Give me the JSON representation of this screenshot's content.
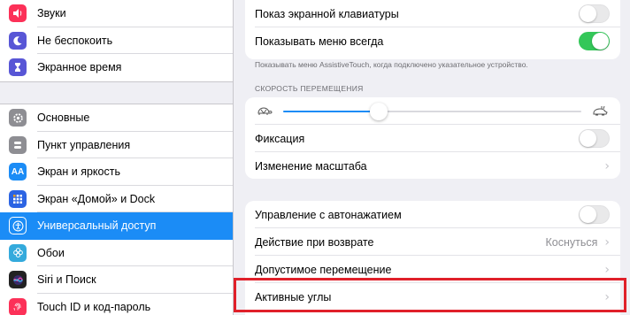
{
  "sidebar": {
    "group1": [
      {
        "label": "Звуки",
        "icon": "speaker-icon",
        "color": "#fc3158"
      },
      {
        "label": "Не беспокоить",
        "icon": "moon-icon",
        "color": "#5856d6"
      },
      {
        "label": "Экранное время",
        "icon": "hourglass-icon",
        "color": "#5856d6"
      }
    ],
    "group2": [
      {
        "label": "Основные",
        "icon": "gear-icon",
        "color": "#8e8e93"
      },
      {
        "label": "Пункт управления",
        "icon": "switches-icon",
        "color": "#8e8e93"
      },
      {
        "label": "Экран и яркость",
        "icon": "aa-icon",
        "color": "#1b8cf6"
      },
      {
        "label": "Экран «Домой» и Dock",
        "icon": "home-grid-icon",
        "color": "#2c64e3"
      },
      {
        "label": "Универсальный доступ",
        "icon": "accessibility-icon",
        "color": "#1b8cf6",
        "selected": true
      },
      {
        "label": "Обои",
        "icon": "flower-icon",
        "color": "#34aadc"
      },
      {
        "label": "Siri и Поиск",
        "icon": "siri-icon",
        "color": "#222"
      },
      {
        "label": "Touch ID и код-пароль",
        "icon": "fingerprint-icon",
        "color": "#fc3158"
      }
    ]
  },
  "main": {
    "card1": {
      "row1": {
        "label": "Показ экранной клавиатуры",
        "toggle": false
      },
      "row2": {
        "label": "Показывать меню всегда",
        "toggle": true
      }
    },
    "note": "Показывать меню AssistiveTouch, когда подключено указательное устройство.",
    "speed_header": "СКОРОСТЬ ПЕРЕМЕЩЕНИЯ",
    "slider": {
      "value": 0.32
    },
    "card2": {
      "fix_label": "Фиксация",
      "fix_toggle": false,
      "zoom_label": "Изменение масштаба"
    },
    "card3": {
      "autoclick_label": "Управление с автонажатием",
      "autoclick_toggle": false,
      "revert_label": "Действие при возврате",
      "revert_value": "Коснуться",
      "tolerance_label": "Допустимое перемещение",
      "corners_label": "Активные углы"
    },
    "chevron": "›"
  },
  "colors": {
    "accent": "#1b8cf6",
    "switch_on": "#34c759",
    "highlight": "#e0202a"
  }
}
